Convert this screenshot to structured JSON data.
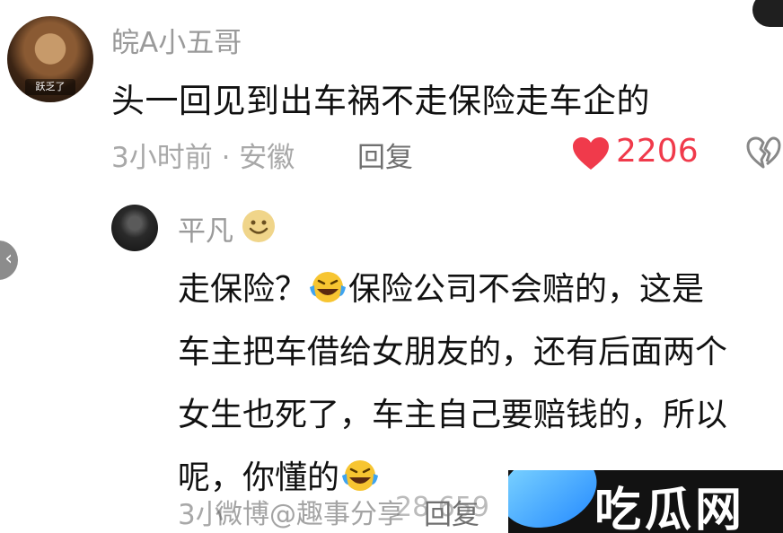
{
  "comment": {
    "username": "皖A小五哥",
    "avatar_caption": "跃乏了",
    "text": "头一回见到出车祸不走保险走车企的",
    "meta": "3小时前 · 安徽",
    "reply_label": "回复",
    "likes": "2206"
  },
  "reply": {
    "username": "平凡",
    "lines": [
      "走保险？",
      "保险公司不会赔的，这是",
      "车主把车借给女朋友的，还有后面两个",
      "女生也死了，车主自己要赔钱的，所以",
      "呢，你懂的"
    ],
    "meta": "3小",
    "reply_label": "回复"
  },
  "watermark": {
    "text": "微博@趣事分享",
    "number": "28  659"
  },
  "logo": {
    "text": "吃瓜网"
  },
  "icons": {
    "like": "heart-icon",
    "dislike": "broken-heart-icon",
    "emoji_smile": "smile-emoji-icon",
    "emoji_laugh_cry": "laugh-cry-emoji-icon",
    "side_nav": "chevron-left-icon"
  },
  "colors": {
    "like": "#f03a4b",
    "meta": "#a8a8a8",
    "logo_bg": "#121212"
  }
}
